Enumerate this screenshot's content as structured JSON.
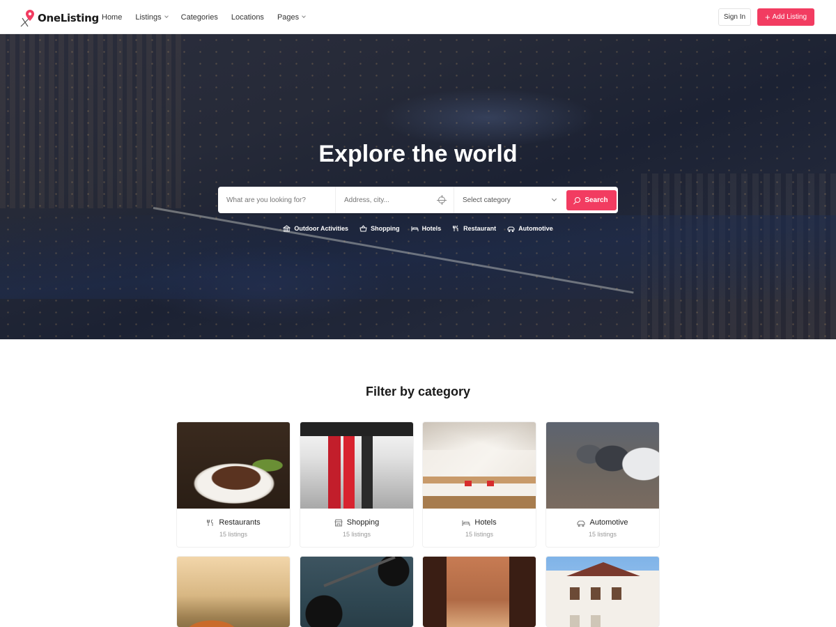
{
  "brand": {
    "name": "OneListing",
    "accent": "#f23c61"
  },
  "nav": {
    "links": [
      {
        "label": "Home",
        "dropdown": false
      },
      {
        "label": "Listings",
        "dropdown": true
      },
      {
        "label": "Categories",
        "dropdown": false
      },
      {
        "label": "Locations",
        "dropdown": false
      },
      {
        "label": "Pages",
        "dropdown": true
      }
    ],
    "sign_in": "Sign In",
    "add_listing": "Add Listing"
  },
  "hero": {
    "title": "Explore the world",
    "search": {
      "what_placeholder": "What are you looking for?",
      "address_placeholder": "Address, city...",
      "category_value": "Select category",
      "button_label": "Search"
    },
    "quick_categories": [
      {
        "label": "Outdoor Activities",
        "icon": "bank-icon"
      },
      {
        "label": "Shopping",
        "icon": "basket-icon"
      },
      {
        "label": "Hotels",
        "icon": "bed-icon"
      },
      {
        "label": "Restaurant",
        "icon": "cutlery-icon"
      },
      {
        "label": "Automotive",
        "icon": "car-icon"
      }
    ]
  },
  "categories": {
    "title": "Filter by category",
    "cards": [
      {
        "label": "Restaurants",
        "count": "15 listings",
        "icon": "cutlery-icon"
      },
      {
        "label": "Shopping",
        "count": "15 listings",
        "icon": "shop-icon"
      },
      {
        "label": "Hotels",
        "count": "15 listings",
        "icon": "bed-icon"
      },
      {
        "label": "Automotive",
        "count": "15 listings",
        "icon": "car-icon"
      }
    ],
    "second_row_images": [
      "mountains",
      "gym",
      "petra",
      "house"
    ]
  }
}
